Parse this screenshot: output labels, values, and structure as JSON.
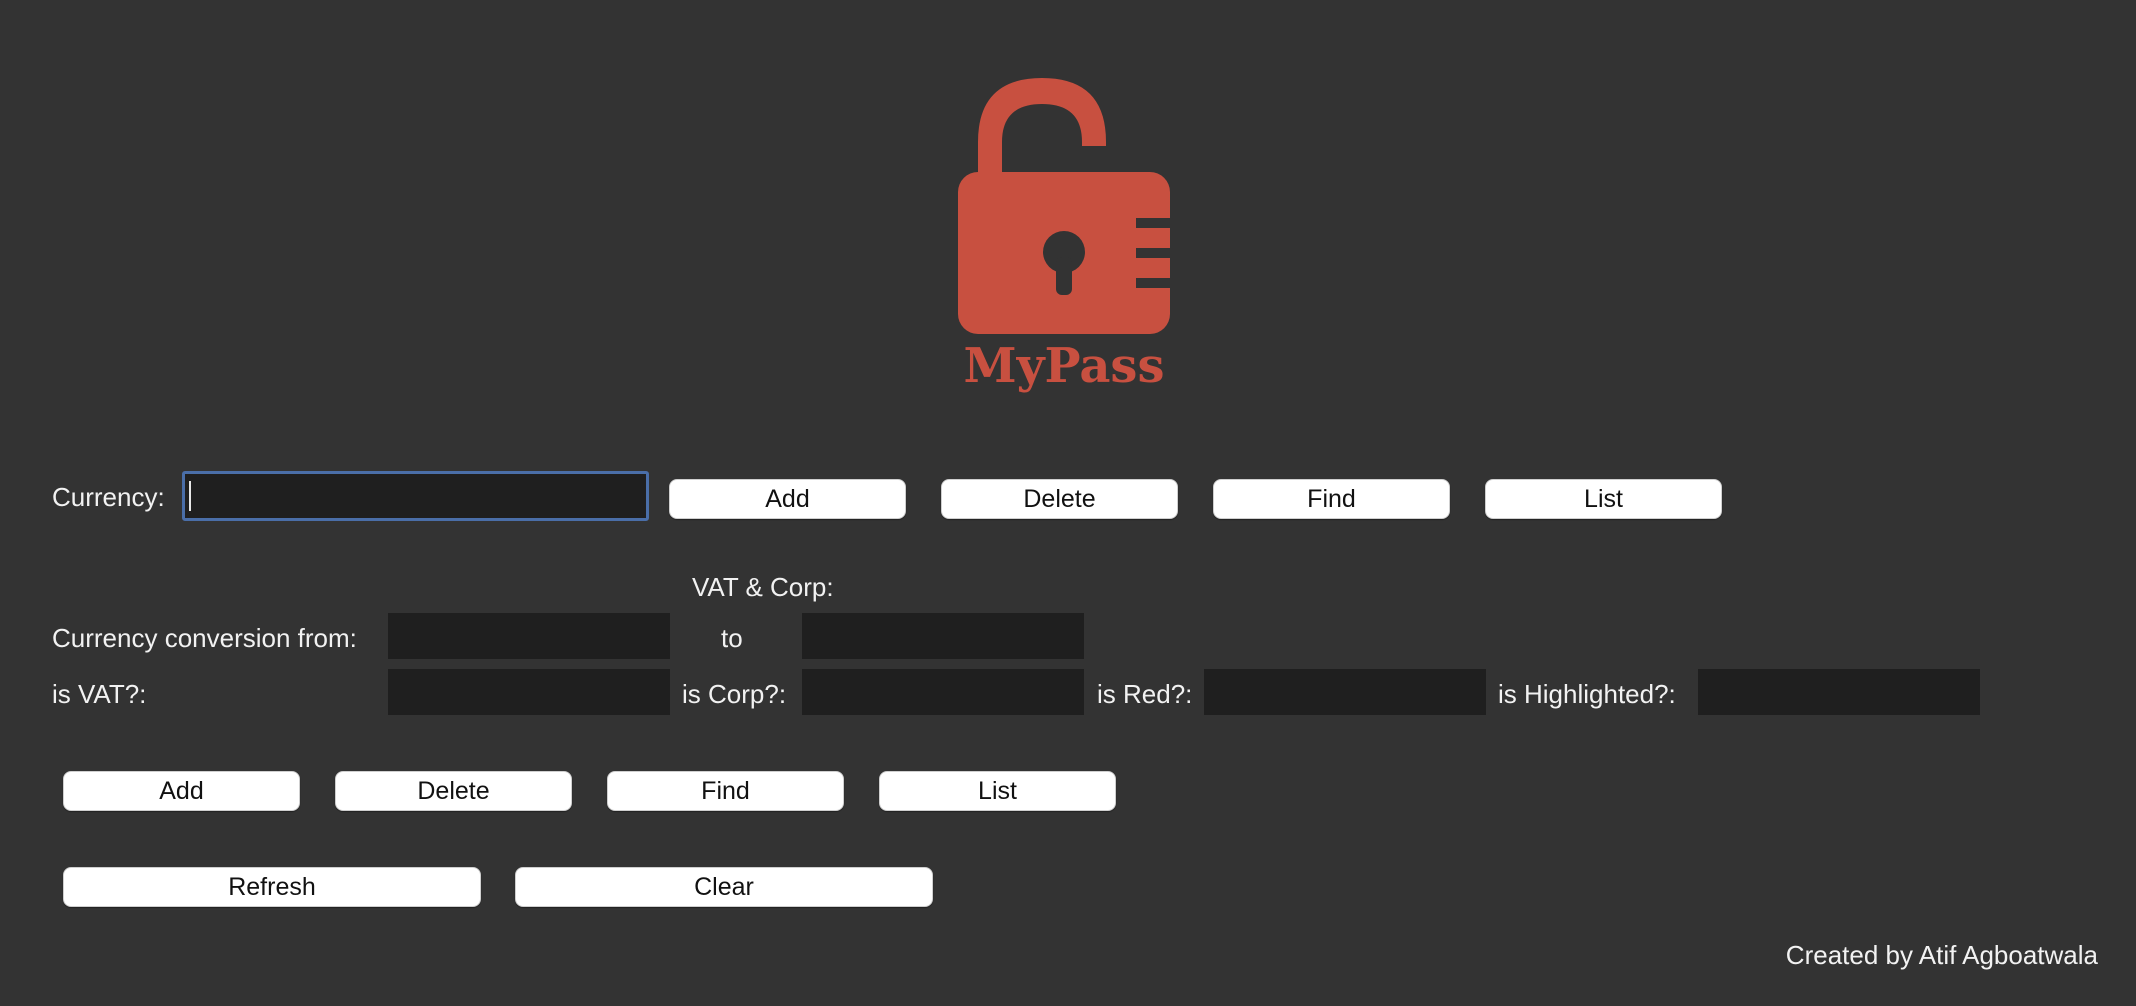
{
  "logo": {
    "text": "MyPass",
    "icon": "padlock-icon",
    "color": "#c85040"
  },
  "currency_row": {
    "label": "Currency:",
    "value": "",
    "buttons": {
      "add": "Add",
      "delete": "Delete",
      "find": "Find",
      "list": "List"
    }
  },
  "vat_section": {
    "heading": "VAT & Corp:",
    "conversion_label": "Currency conversion from:",
    "conversion_from_value": "",
    "to_label": "to",
    "conversion_to_value": "",
    "is_vat_label": "is VAT?:",
    "is_vat_value": "",
    "is_corp_label": "is Corp?:",
    "is_corp_value": "",
    "is_red_label": "is Red?:",
    "is_red_value": "",
    "is_highlighted_label": "is Highlighted?:",
    "is_highlighted_value": "",
    "buttons": {
      "add": "Add",
      "delete": "Delete",
      "find": "Find",
      "list": "List"
    }
  },
  "actions": {
    "refresh": "Refresh",
    "clear": "Clear"
  },
  "footer": {
    "credit": "Created by Atif Agboatwala"
  },
  "colors": {
    "background": "#333333",
    "field": "#1f1f1f",
    "focus_border": "#4a6ea8",
    "button": "#ffffff",
    "logo": "#c85040"
  }
}
